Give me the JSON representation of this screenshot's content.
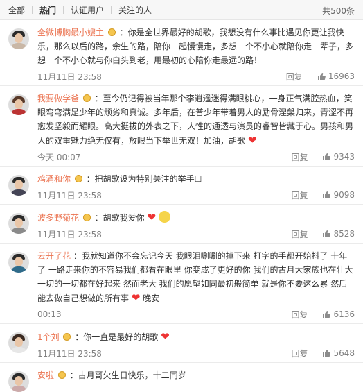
{
  "tabs": [
    {
      "label": "全部"
    },
    {
      "label": "热门"
    },
    {
      "label": "认证用户"
    },
    {
      "label": "关注的人"
    }
  ],
  "total": "共500条",
  "colors": {
    "username": "#eb7350",
    "accent_heart": "#e33333",
    "meta": "#808080"
  },
  "icons": {
    "badge": "badge-icon",
    "like": "thumbs-up-icon",
    "heart": "heart-emoji"
  },
  "comments": [
    {
      "user": "全微博胸最小嫂主",
      "text": "：你是全世界最好的胡歌，我想没有什么事比遇见你更让我快乐，那么以后的路，余生的路，陪你一起慢慢走，多想一个不小心就陪你走一辈子，多想一个不小心就与你白头到老，用最初的心陪你走最远的路！",
      "time": "11月11日 23:58",
      "reply": "回复",
      "likes": "16963"
    },
    {
      "user": "我要做学爸",
      "text": "：至今仍记得被当年那个李逍遥迷得满眼桃心，一身正气满腔热血，笑眼弯弯满是少年的顽劣和真诚。多年后，在普少年带着男人的励骨涅槃归来，青涩不再愈发坚毅而耀眼。高大挺拔的外表之下，人性的通透与演员的睿智皆藏于心。男孩和男人的双重魅力绝无仅有，放眼当下举世无双！加油，胡歌",
      "time": "今天 00:07",
      "reply": "回复",
      "likes": "9343"
    },
    {
      "user": "鸡涌和你",
      "text": "：把胡歌设为特别关注的举手☐",
      "time": "11月11日 23:58",
      "reply": "回复",
      "likes": "9098"
    },
    {
      "user": "波多野菊花",
      "text": "：胡歌我爱你",
      "time": "11月11日 23:58",
      "reply": "回复",
      "likes": "8528"
    },
    {
      "user": "云开了花",
      "text": "：我就知道你不会忘记今天 我眼泪唰唰的掉下来 打字的手都开始抖了 十年了 一路走来你的不容易我们都看在眼里 你变成了更好的你 我们的古月大家族也在壮大 一切的一切都在好起来 然而老大 我们的愿望如同最初般简单 就是你不要这么累 然后能去做自己想做的所有事",
      "text2": "晚安",
      "time": "00:13",
      "reply": "回复",
      "likes": "6136"
    },
    {
      "user": "1个刘",
      "text": "：你一直是最好的胡歌",
      "time": "11月11日 23:58",
      "reply": "回复",
      "likes": "5648"
    },
    {
      "user": "安啦",
      "text": "：古月哥欠生日快乐，十二同岁",
      "time": "",
      "reply": "",
      "likes": ""
    }
  ]
}
